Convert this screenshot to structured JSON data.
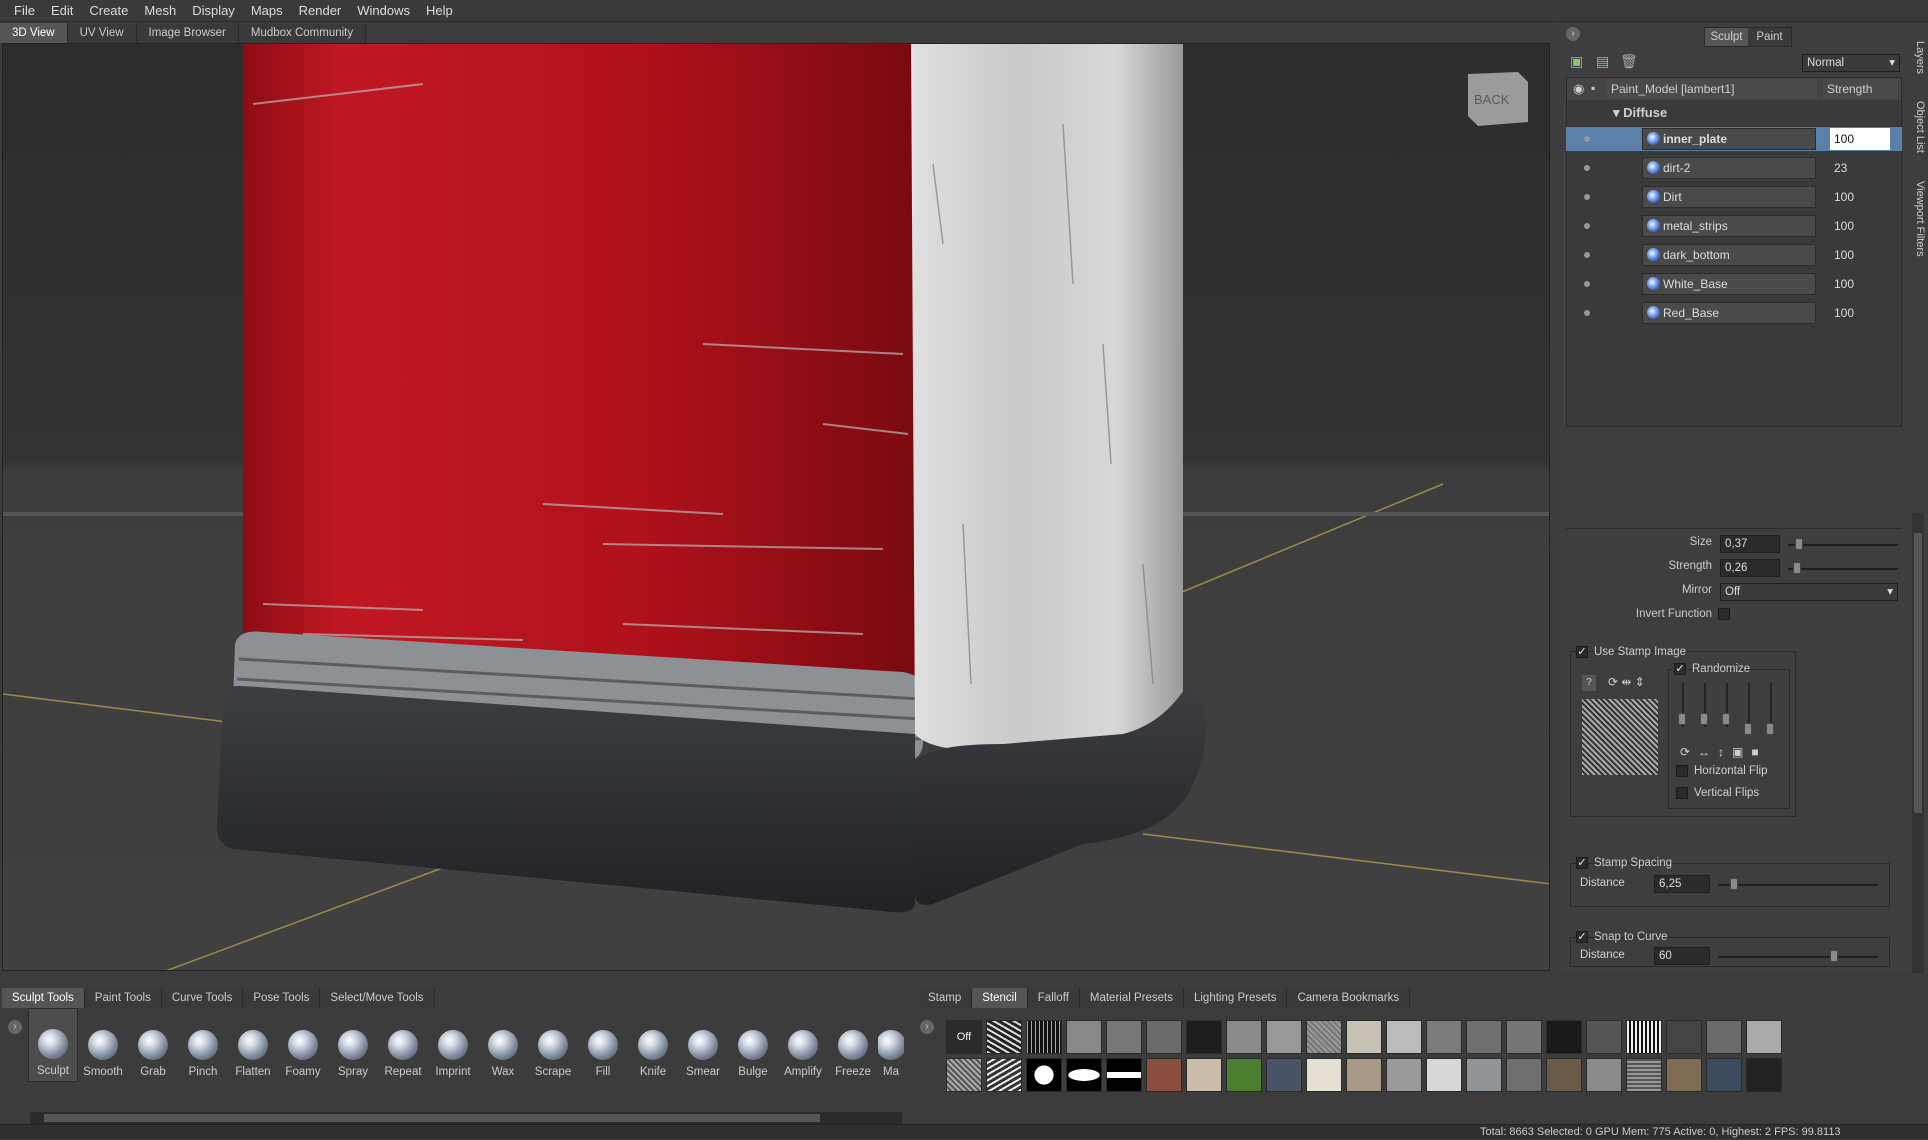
{
  "menu": [
    "File",
    "Edit",
    "Create",
    "Mesh",
    "Display",
    "Maps",
    "Render",
    "Windows",
    "Help"
  ],
  "view_tabs": [
    "3D View",
    "UV View",
    "Image Browser",
    "Mudbox Community"
  ],
  "viewcube_label": "BACK",
  "right_side_tabs": [
    "Layers",
    "Object List",
    "Viewport Filters"
  ],
  "mode_tabs": {
    "sculpt": "Sculpt",
    "paint": "Paint"
  },
  "blend_mode": "Normal",
  "layers_header": {
    "name": "Paint_Model [lambert1]",
    "strength": "Strength"
  },
  "group_name": "Diffuse",
  "layers": [
    {
      "name": "inner_plate",
      "value": "100"
    },
    {
      "name": "dirt-2",
      "value": "23"
    },
    {
      "name": "Dirt",
      "value": "100"
    },
    {
      "name": "metal_strips",
      "value": "100"
    },
    {
      "name": "dark_bottom",
      "value": "100"
    },
    {
      "name": "White_Base",
      "value": "100"
    },
    {
      "name": "Red_Base",
      "value": "100"
    }
  ],
  "properties": {
    "size_label": "Size",
    "size_value": "0,37",
    "size_fraction": 0.37,
    "strength_label": "Strength",
    "strength_value": "0,26",
    "strength_fraction": 0.26,
    "mirror_label": "Mirror",
    "mirror_value": "Off",
    "invert_label": "Invert Function",
    "use_stamp_label": "Use Stamp Image",
    "randomize_label": "Randomize",
    "hflip_label": "Horizontal Flip",
    "vflip_label": "Vertical Flips",
    "stamp_spacing_label": "Stamp Spacing",
    "distance_label": "Distance",
    "distance_value": "6,25",
    "snap_label": "Snap to Curve",
    "snap_distance_label": "Distance",
    "snap_distance_value": "60"
  },
  "tool_tabs": [
    "Sculpt Tools",
    "Paint Tools",
    "Curve Tools",
    "Pose Tools",
    "Select/Move Tools"
  ],
  "tools": [
    "Sculpt",
    "Smooth",
    "Grab",
    "Pinch",
    "Flatten",
    "Foamy",
    "Spray",
    "Repeat",
    "Imprint",
    "Wax",
    "Scrape",
    "Fill",
    "Knife",
    "Smear",
    "Bulge",
    "Amplify",
    "Freeze",
    "Ma"
  ],
  "stamp_tabs": [
    "Stamp",
    "Stencil",
    "Falloff",
    "Material Presets",
    "Lighting Presets",
    "Camera Bookmarks"
  ],
  "stamp_off_label": "Off",
  "status": "Total: 8663  Selected: 0 GPU Mem: 775  Active: 0, Highest: 2  FPS: 99.8113",
  "colors": {
    "accent": "#5a7fa8",
    "red_paint": "#b4121c",
    "panel": "#3e3e3e"
  }
}
